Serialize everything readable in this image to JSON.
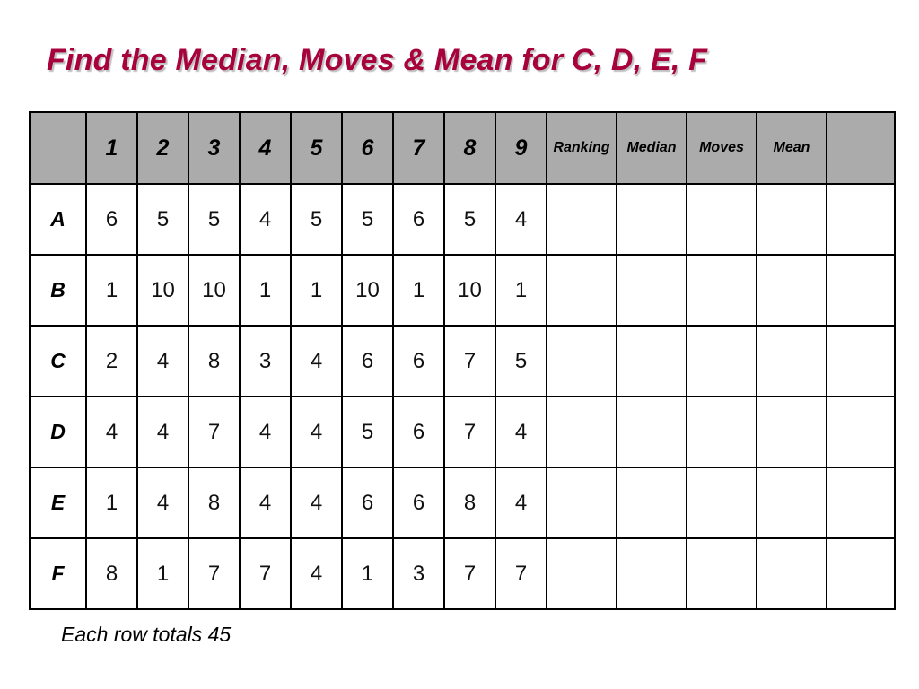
{
  "slide": {
    "title": "Find the Median, Moves & Mean for C, D, E, F",
    "title_color": "#A8023C",
    "footer_note": "Each row totals 45",
    "header_fill": "#ABABAB",
    "border_color": "#000000"
  },
  "table": {
    "corner_label": "",
    "column_headers": [
      "1",
      "2",
      "3",
      "4",
      "5",
      "6",
      "7",
      "8",
      "9"
    ],
    "stat_headers": [
      "Ranking",
      "Median",
      "Moves",
      "Mean"
    ],
    "trailing_blank_header": "",
    "rows": [
      {
        "label": "A",
        "values": [
          "6",
          "5",
          "5",
          "4",
          "5",
          "5",
          "6",
          "5",
          "4"
        ],
        "ranking": "",
        "median": "",
        "moves": "",
        "mean": "",
        "extra": ""
      },
      {
        "label": "B",
        "values": [
          "1",
          "10",
          "10",
          "1",
          "1",
          "10",
          "1",
          "10",
          "1"
        ],
        "ranking": "",
        "median": "",
        "moves": "",
        "mean": "",
        "extra": ""
      },
      {
        "label": "C",
        "values": [
          "2",
          "4",
          "8",
          "3",
          "4",
          "6",
          "6",
          "7",
          "5"
        ],
        "ranking": "",
        "median": "",
        "moves": "",
        "mean": "",
        "extra": ""
      },
      {
        "label": "D",
        "values": [
          "4",
          "4",
          "7",
          "4",
          "4",
          "5",
          "6",
          "7",
          "4"
        ],
        "ranking": "",
        "median": "",
        "moves": "",
        "mean": "",
        "extra": ""
      },
      {
        "label": "E",
        "values": [
          "1",
          "4",
          "8",
          "4",
          "4",
          "6",
          "6",
          "8",
          "4"
        ],
        "ranking": "",
        "median": "",
        "moves": "",
        "mean": "",
        "extra": ""
      },
      {
        "label": "F",
        "values": [
          "8",
          "1",
          "7",
          "7",
          "4",
          "1",
          "3",
          "7",
          "7"
        ],
        "ranking": "",
        "median": "",
        "moves": "",
        "mean": "",
        "extra": ""
      }
    ]
  }
}
